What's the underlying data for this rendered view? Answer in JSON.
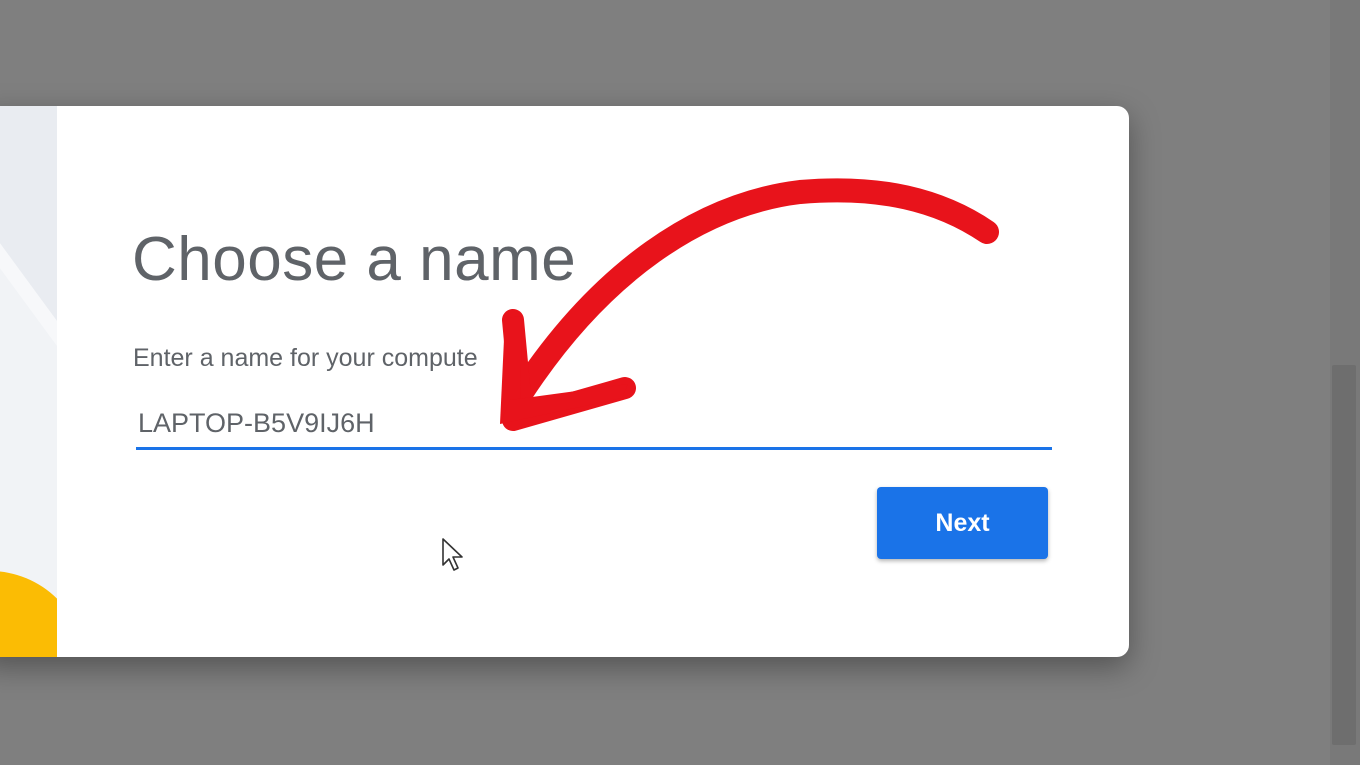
{
  "dialog": {
    "title": "Choose a name",
    "subtitle": "Enter a name for your compute",
    "name_input": {
      "value": "LAPTOP-B5V9IJ6H",
      "placeholder": ""
    },
    "next_label": "Next"
  },
  "icons": {
    "cursor": "mouse-pointer-icon",
    "annotation": "red-arrow-annotation"
  },
  "colors": {
    "background": "#7f7f7f",
    "accent": "#1a73e8",
    "annotation": "#e8131b",
    "side_art_yellow": "#fbbc04"
  }
}
